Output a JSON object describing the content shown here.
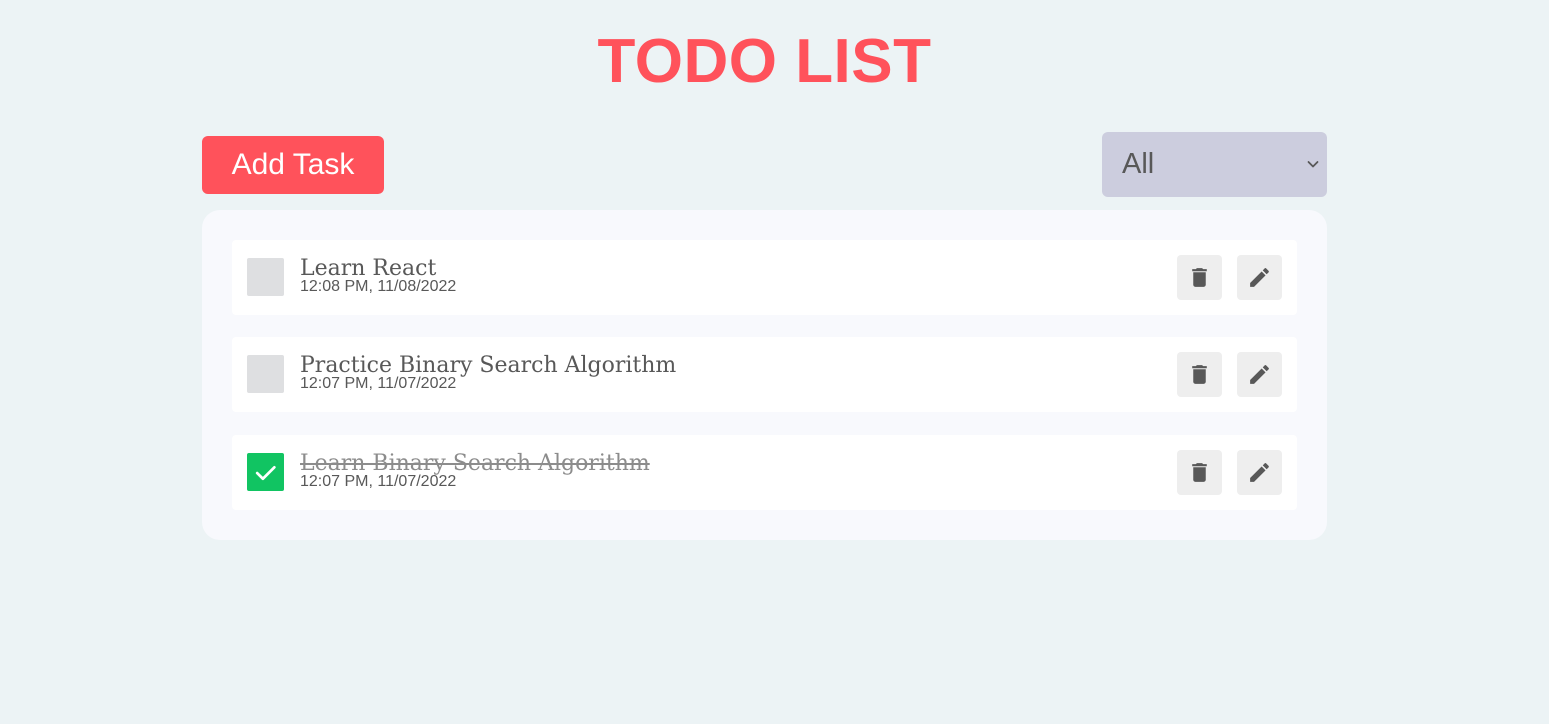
{
  "header": {
    "title": "TODO LIST"
  },
  "toolbar": {
    "add_label": "Add Task",
    "filter": {
      "selected": "All"
    }
  },
  "colors": {
    "accent": "#ff525b",
    "background": "#ecf3f5",
    "panel": "#f8f9fd",
    "select_bg": "#cccdde",
    "checked": "#11c462",
    "unchecked": "#dedfe1"
  },
  "todos": [
    {
      "title": "Learn React",
      "time": "12:08 PM, 11/08/2022",
      "completed": false
    },
    {
      "title": "Practice Binary Search Algorithm",
      "time": "12:07 PM, 11/07/2022",
      "completed": false
    },
    {
      "title": "Learn Binary Search Algorithm",
      "time": "12:07 PM, 11/07/2022",
      "completed": true
    }
  ],
  "icons": {
    "delete": "trash-icon",
    "edit": "pencil-icon",
    "dropdown": "chevron-down-icon",
    "check": "check-icon"
  }
}
